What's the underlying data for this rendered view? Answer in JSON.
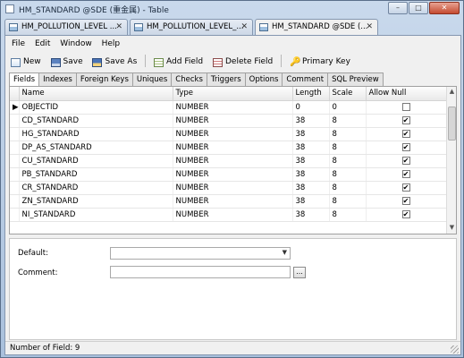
{
  "window": {
    "title": "HM_STANDARD @SDE (重金属) - Table",
    "minimize": "–",
    "maximize": "□",
    "close": "✕"
  },
  "doc_tabs": [
    {
      "label": "HM_POLLUTION_LEVEL ...",
      "close": "✕"
    },
    {
      "label": "HM_POLLUTION_LEVEL_...",
      "close": "✕"
    },
    {
      "label": "HM_STANDARD @SDE (...",
      "close": "✕"
    }
  ],
  "menu": [
    "File",
    "Edit",
    "Window",
    "Help"
  ],
  "toolbar": {
    "new": "New",
    "save": "Save",
    "save_as": "Save As",
    "add_field": "Add Field",
    "delete_field": "Delete Field",
    "primary_key": "Primary Key",
    "key_glyph": "🔑"
  },
  "panel_tabs": [
    "Fields",
    "Indexes",
    "Foreign Keys",
    "Uniques",
    "Checks",
    "Triggers",
    "Options",
    "Comment",
    "SQL Preview"
  ],
  "grid": {
    "headers": {
      "name": "Name",
      "type": "Type",
      "length": "Length",
      "scale": "Scale",
      "allow_null": "Allow Null"
    },
    "current_row_marker": "▶",
    "check_mark": "✔",
    "rows": [
      {
        "name": "OBJECTID",
        "type": "NUMBER",
        "length": "0",
        "scale": "0",
        "allow_null": false
      },
      {
        "name": "CD_STANDARD",
        "type": "NUMBER",
        "length": "38",
        "scale": "8",
        "allow_null": true
      },
      {
        "name": "HG_STANDARD",
        "type": "NUMBER",
        "length": "38",
        "scale": "8",
        "allow_null": true
      },
      {
        "name": "DP_AS_STANDARD",
        "type": "NUMBER",
        "length": "38",
        "scale": "8",
        "allow_null": true
      },
      {
        "name": "CU_STANDARD",
        "type": "NUMBER",
        "length": "38",
        "scale": "8",
        "allow_null": true
      },
      {
        "name": "PB_STANDARD",
        "type": "NUMBER",
        "length": "38",
        "scale": "8",
        "allow_null": true
      },
      {
        "name": "CR_STANDARD",
        "type": "NUMBER",
        "length": "38",
        "scale": "8",
        "allow_null": true
      },
      {
        "name": "ZN_STANDARD",
        "type": "NUMBER",
        "length": "38",
        "scale": "8",
        "allow_null": true
      },
      {
        "name": "NI_STANDARD",
        "type": "NUMBER",
        "length": "38",
        "scale": "8",
        "allow_null": true
      }
    ],
    "scroll_up": "▲",
    "scroll_down": "▼"
  },
  "properties": {
    "default_label": "Default:",
    "default_value": "",
    "dropdown_arrow": "▼",
    "comment_label": "Comment:",
    "comment_value": "",
    "ellipsis": "..."
  },
  "status": {
    "text": "Number of Field: 9"
  },
  "icons": {
    "window": "table-icon",
    "new": "new-table-icon",
    "save": "save-icon",
    "save_as": "save-as-icon",
    "add_field": "add-field-icon",
    "delete_field": "delete-field-icon",
    "primary_key": "key-icon"
  }
}
